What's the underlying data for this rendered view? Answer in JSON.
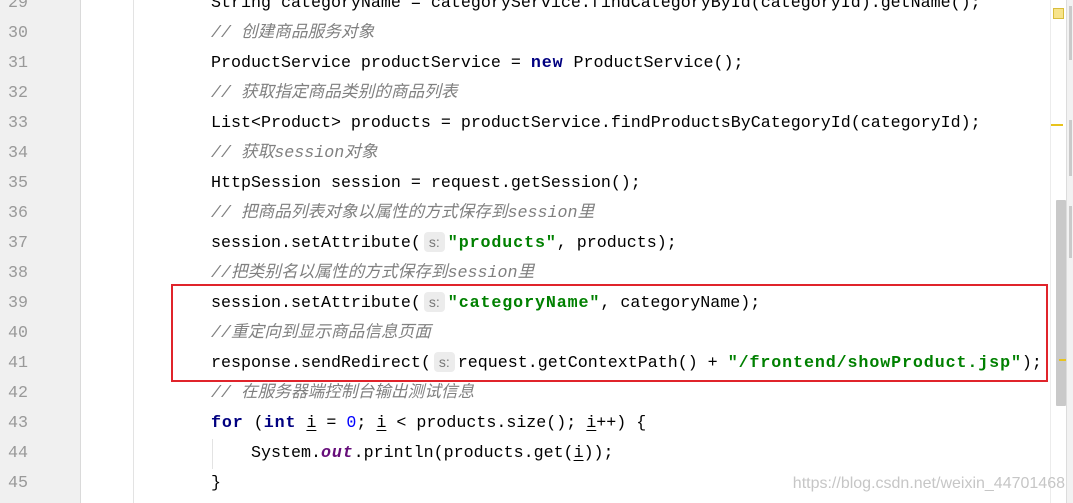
{
  "editor": {
    "lines": [
      {
        "number": 29,
        "tokens": [
          {
            "kind": "plain",
            "text": "String categoryName = categoryService.findCategoryById(categoryId).getName();"
          }
        ]
      },
      {
        "number": 30,
        "tokens": [
          {
            "kind": "comment",
            "text": "// 创建商品服务对象"
          }
        ]
      },
      {
        "number": 31,
        "tokens": [
          {
            "kind": "plain",
            "text": "ProductService productService = "
          },
          {
            "kind": "keyword",
            "text": "new"
          },
          {
            "kind": "plain",
            "text": " ProductService();"
          }
        ]
      },
      {
        "number": 32,
        "tokens": [
          {
            "kind": "comment",
            "text": "// 获取指定商品类别的商品列表"
          }
        ]
      },
      {
        "number": 33,
        "tokens": [
          {
            "kind": "plain",
            "text": "List<Product> products = productService.findProductsByCategoryId(categoryId);"
          }
        ]
      },
      {
        "number": 34,
        "tokens": [
          {
            "kind": "comment",
            "text": "// 获取session对象"
          }
        ]
      },
      {
        "number": 35,
        "tokens": [
          {
            "kind": "plain",
            "text": "HttpSession session = request.getSession();"
          }
        ]
      },
      {
        "number": 36,
        "tokens": [
          {
            "kind": "comment",
            "text": "// 把商品列表对象以属性的方式保存到session里"
          }
        ]
      },
      {
        "number": 37,
        "tokens": [
          {
            "kind": "plain",
            "text": "session.setAttribute("
          },
          {
            "kind": "param_hint",
            "text": "s:"
          },
          {
            "kind": "string",
            "text": "\"products\""
          },
          {
            "kind": "plain",
            "text": ", products);"
          }
        ]
      },
      {
        "number": 38,
        "tokens": [
          {
            "kind": "comment",
            "text": "//把类别名以属性的方式保存到session里"
          }
        ]
      },
      {
        "number": 39,
        "tokens": [
          {
            "kind": "plain",
            "text": "session.setAttribute("
          },
          {
            "kind": "param_hint",
            "text": "s:"
          },
          {
            "kind": "string",
            "text": "\"categoryName\""
          },
          {
            "kind": "plain",
            "text": ", categoryName);"
          }
        ]
      },
      {
        "number": 40,
        "tokens": [
          {
            "kind": "comment",
            "text": "//重定向到显示商品信息页面"
          }
        ]
      },
      {
        "number": 41,
        "tokens": [
          {
            "kind": "plain",
            "text": "response.sendRedirect("
          },
          {
            "kind": "param_hint",
            "text": "s:"
          },
          {
            "kind": "plain",
            "text": "request.getContextPath() + "
          },
          {
            "kind": "string",
            "text": "\"/frontend/showProduct.jsp\""
          },
          {
            "kind": "plain",
            "text": ");"
          }
        ]
      },
      {
        "number": 42,
        "tokens": [
          {
            "kind": "comment",
            "text": "// 在服务器端控制台输出测试信息"
          }
        ]
      },
      {
        "number": 43,
        "tokens": [
          {
            "kind": "keyword",
            "text": "for"
          },
          {
            "kind": "plain",
            "text": " ("
          },
          {
            "kind": "keyword",
            "text": "int"
          },
          {
            "kind": "plain",
            "text": " "
          },
          {
            "kind": "reassigned_var",
            "text": "i"
          },
          {
            "kind": "plain",
            "text": " = "
          },
          {
            "kind": "number",
            "text": "0"
          },
          {
            "kind": "plain",
            "text": "; "
          },
          {
            "kind": "reassigned_var",
            "text": "i"
          },
          {
            "kind": "plain",
            "text": " < products.size(); "
          },
          {
            "kind": "reassigned_var",
            "text": "i"
          },
          {
            "kind": "plain",
            "text": "++) {"
          }
        ]
      },
      {
        "number": 44,
        "tokens": [
          {
            "kind": "plain",
            "text": "System."
          },
          {
            "kind": "static_field",
            "text": "out"
          },
          {
            "kind": "plain",
            "text": ".println(products.get("
          },
          {
            "kind": "reassigned_var",
            "text": "i"
          },
          {
            "kind": "plain",
            "text": "));"
          }
        ]
      },
      {
        "number": 45,
        "tokens": [
          {
            "kind": "plain",
            "text": "}"
          }
        ]
      }
    ]
  },
  "syntax_colors": {
    "plain": "#000000",
    "keyword": "#000080",
    "string": "#008000",
    "number": "#0000ff",
    "comment": "#808080",
    "static_field": "#660e7a",
    "param_hint": "#787878",
    "line_number": "#999999"
  },
  "annotation": {
    "color": "#e0242b"
  },
  "error_stripe": {
    "warning_color": "#e8c31c"
  },
  "watermark": "https://blog.csdn.net/weixin_44701468"
}
